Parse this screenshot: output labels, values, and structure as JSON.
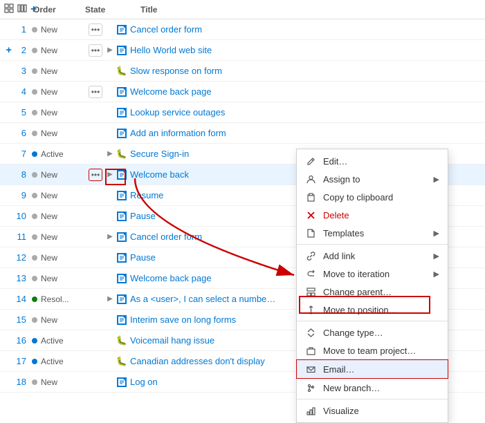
{
  "header": {
    "icons": [
      "grid-icon",
      "columns-icon",
      "plus-header-icon"
    ],
    "columns": [
      "Order",
      "State",
      "Title"
    ]
  },
  "rows": [
    {
      "order": 1,
      "state": "New",
      "stateType": "new",
      "hasDots": true,
      "hasArrow": false,
      "isPlus": false,
      "icon": "story",
      "title": "Cancel order form"
    },
    {
      "order": 2,
      "state": "New",
      "stateType": "new",
      "hasDots": true,
      "hasArrow": true,
      "isPlus": true,
      "icon": "story",
      "title": "Hello World web site"
    },
    {
      "order": 3,
      "state": "New",
      "stateType": "new",
      "hasDots": false,
      "hasArrow": false,
      "isPlus": false,
      "icon": "bug",
      "title": "Slow response on form"
    },
    {
      "order": 4,
      "state": "New",
      "stateType": "new",
      "hasDots": true,
      "hasArrow": false,
      "isPlus": false,
      "icon": "story",
      "title": "Welcome back page"
    },
    {
      "order": 5,
      "state": "New",
      "stateType": "new",
      "hasDots": false,
      "hasArrow": false,
      "isPlus": false,
      "icon": "story",
      "title": "Lookup service outages"
    },
    {
      "order": 6,
      "state": "New",
      "stateType": "new",
      "hasDots": false,
      "hasArrow": false,
      "isPlus": false,
      "icon": "story",
      "title": "Add an information form"
    },
    {
      "order": 7,
      "state": "Active",
      "stateType": "active",
      "hasDots": false,
      "hasArrow": true,
      "isPlus": false,
      "icon": "bug",
      "title": "Secure Sign-in"
    },
    {
      "order": 8,
      "state": "New",
      "stateType": "new",
      "hasDots": true,
      "hasArrow": true,
      "isPlus": false,
      "icon": "story",
      "title": "Welcome back",
      "active": true
    },
    {
      "order": 9,
      "state": "New",
      "stateType": "new",
      "hasDots": false,
      "hasArrow": false,
      "isPlus": false,
      "icon": "story",
      "title": "Resume"
    },
    {
      "order": 10,
      "state": "New",
      "stateType": "new",
      "hasDots": false,
      "hasArrow": false,
      "isPlus": false,
      "icon": "story",
      "title": "Pause"
    },
    {
      "order": 11,
      "state": "New",
      "stateType": "new",
      "hasDots": false,
      "hasArrow": true,
      "isPlus": false,
      "icon": "story",
      "title": "Cancel order form"
    },
    {
      "order": 12,
      "state": "New",
      "stateType": "new",
      "hasDots": false,
      "hasArrow": false,
      "isPlus": false,
      "icon": "story",
      "title": "Pause"
    },
    {
      "order": 13,
      "state": "New",
      "stateType": "new",
      "hasDots": false,
      "hasArrow": false,
      "isPlus": false,
      "icon": "story",
      "title": "Welcome back page"
    },
    {
      "order": 14,
      "state": "Resol...",
      "stateType": "resolved",
      "hasDots": false,
      "hasArrow": true,
      "isPlus": false,
      "icon": "story",
      "title": "As a <user>, I can select a numbe…"
    },
    {
      "order": 15,
      "state": "New",
      "stateType": "new",
      "hasDots": false,
      "hasArrow": false,
      "isPlus": false,
      "icon": "story",
      "title": "Interim save on long forms"
    },
    {
      "order": 16,
      "state": "Active",
      "stateType": "active",
      "hasDots": false,
      "hasArrow": false,
      "isPlus": false,
      "icon": "bug",
      "title": "Voicemail hang issue"
    },
    {
      "order": 17,
      "state": "Active",
      "stateType": "active",
      "hasDots": false,
      "hasArrow": false,
      "isPlus": false,
      "icon": "bug",
      "title": "Canadian addresses don't display"
    },
    {
      "order": 18,
      "state": "New",
      "stateType": "new",
      "hasDots": false,
      "hasArrow": false,
      "isPlus": false,
      "icon": "story",
      "title": "Log on"
    }
  ],
  "contextMenu": {
    "items": [
      {
        "id": "edit",
        "label": "Edit…",
        "icon": "pencil",
        "hasArrow": false,
        "highlighted": false
      },
      {
        "id": "assign",
        "label": "Assign to",
        "icon": "person",
        "hasArrow": true,
        "highlighted": false
      },
      {
        "id": "copy",
        "label": "Copy to clipboard",
        "icon": "clipboard",
        "hasArrow": false,
        "highlighted": false
      },
      {
        "id": "delete",
        "label": "Delete",
        "icon": "x",
        "hasArrow": false,
        "highlighted": false,
        "danger": true
      },
      {
        "id": "templates",
        "label": "Templates",
        "icon": "doc",
        "hasArrow": true,
        "highlighted": false
      },
      {
        "id": "divider1",
        "label": "",
        "icon": "",
        "isDivider": true
      },
      {
        "id": "addlink",
        "label": "Add link",
        "icon": "link",
        "hasArrow": true,
        "highlighted": false
      },
      {
        "id": "moveiteration",
        "label": "Move to iteration",
        "icon": "iteration",
        "hasArrow": true,
        "highlighted": false
      },
      {
        "id": "changeparent",
        "label": "Change parent…",
        "icon": "parent",
        "hasArrow": false,
        "highlighted": false
      },
      {
        "id": "moveposition",
        "label": "Move to position…",
        "icon": "position",
        "hasArrow": false,
        "highlighted": false
      },
      {
        "id": "divider2",
        "label": "",
        "icon": "",
        "isDivider": true
      },
      {
        "id": "changetype",
        "label": "Change type…",
        "icon": "arrows",
        "hasArrow": false,
        "highlighted": false
      },
      {
        "id": "movetoteam",
        "label": "Move to team project…",
        "icon": "teamproject",
        "hasArrow": false,
        "highlighted": false
      },
      {
        "id": "email",
        "label": "Email…",
        "icon": "email",
        "hasArrow": false,
        "highlighted": true
      },
      {
        "id": "newbranch",
        "label": "New branch…",
        "icon": "branch",
        "hasArrow": false,
        "highlighted": false
      },
      {
        "id": "divider3",
        "label": "",
        "icon": "",
        "isDivider": true
      },
      {
        "id": "visualize",
        "label": "Visualize",
        "icon": "chart",
        "hasArrow": false,
        "highlighted": false
      }
    ]
  }
}
